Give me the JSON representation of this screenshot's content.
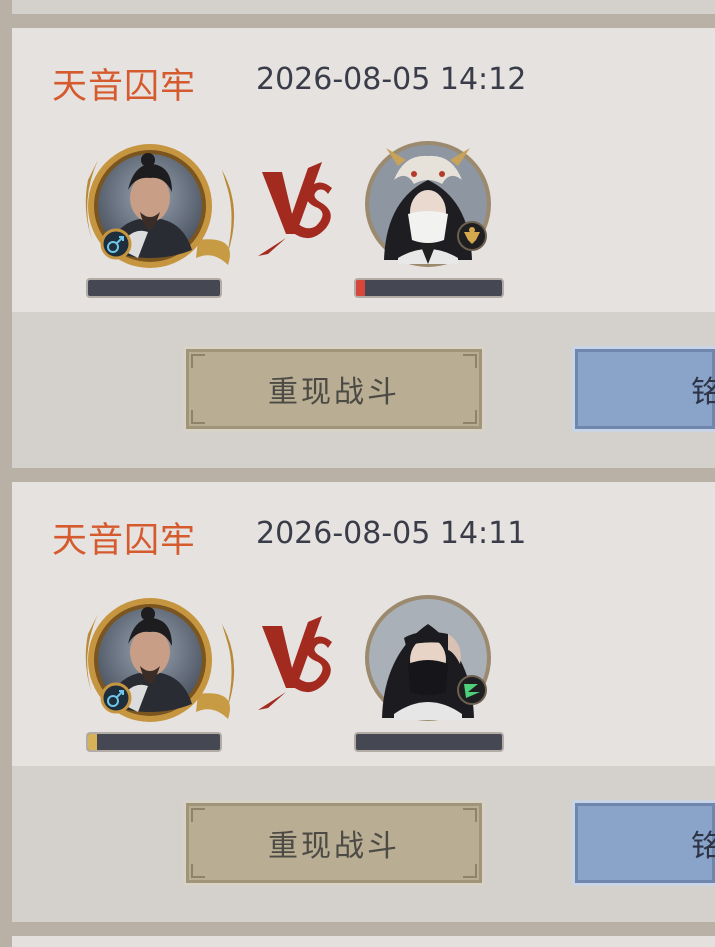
{
  "battles": [
    {
      "map": "天音囚牢",
      "time": "2026-08-05 14:12",
      "player_gender_icon": "male-icon",
      "player_hp_fraction": 0.0,
      "opponent_badge_icon": "gold-emblem-icon",
      "opponent_hp_fraction": 0.06,
      "replay_label": "重现战斗",
      "blue_label": "铭"
    },
    {
      "map": "天音囚牢",
      "time": "2026-08-05 14:11",
      "player_gender_icon": "male-icon",
      "player_hp_fraction": 0.07,
      "opponent_badge_icon": "green-emblem-icon",
      "opponent_hp_fraction": 0.0,
      "replay_label": "重现战斗",
      "blue_label": "铭"
    }
  ],
  "colors": {
    "map_name": "#d55a2e",
    "vs": "#a22a1f",
    "hp_red": "#d7463a",
    "hp_gold": "#d6b15a"
  }
}
